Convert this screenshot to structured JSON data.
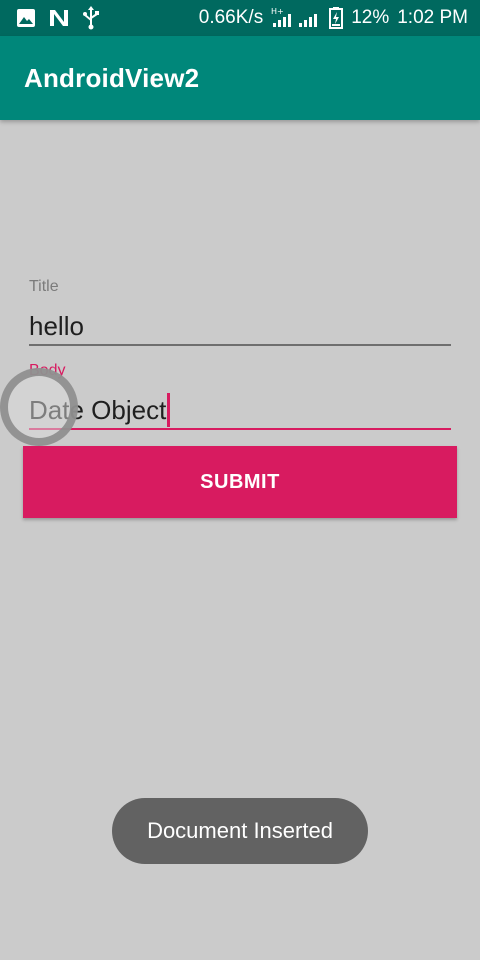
{
  "status_bar": {
    "icons_left": [
      "image-icon",
      "n-notification-icon",
      "usb-icon"
    ],
    "network_speed": "0.66K/s",
    "network_type": "H+",
    "battery_percent": "12%",
    "time": "1:02 PM"
  },
  "app_bar": {
    "title": "AndroidView2"
  },
  "form": {
    "title_label": "Title",
    "title_value": "hello",
    "body_label": "Body",
    "body_value": "Date Object",
    "submit_label": "SUBMIT"
  },
  "toast": {
    "message": "Document Inserted"
  },
  "colors": {
    "status_bar": "#00695f",
    "app_bar": "#00877a",
    "accent": "#d81b60",
    "background": "#cbcbcb",
    "toast": "#626262"
  }
}
